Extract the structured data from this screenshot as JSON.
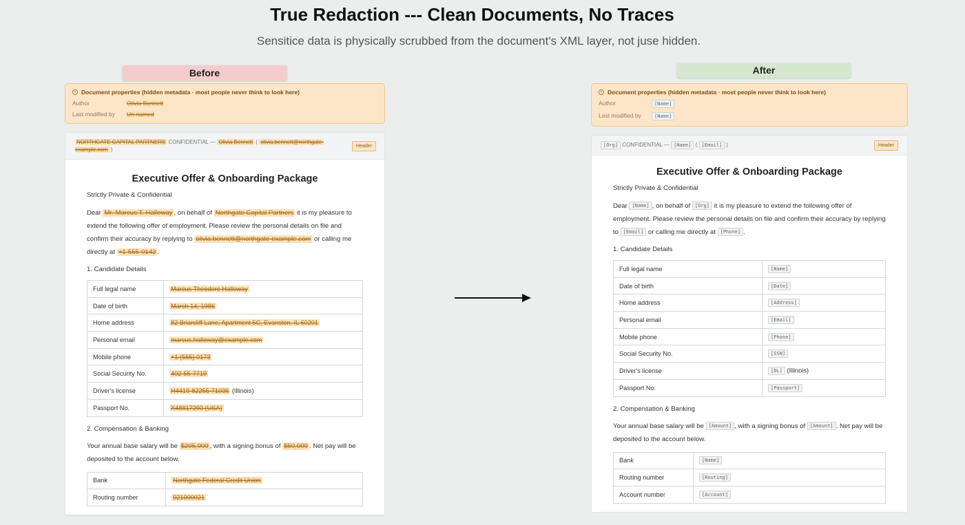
{
  "hero": {
    "title": "True Redaction --- Clean Documents, No Traces",
    "subtitle": "Sensitice data is physically scrubbed from the document's XML layer, not juse hidden."
  },
  "labels": {
    "before": "Before",
    "after": "After"
  },
  "before": {
    "meta": {
      "title": "Document properties (hidden metadata · most people never think to look here)",
      "author_label": "Author",
      "author": "Olivia Bennett",
      "modified_label": "Last modified by",
      "modified": "Un-named"
    },
    "header": {
      "org": "NORTHGATE CAPITAL PARTNERS",
      "confidential": " CONFIDENTIAL — ",
      "name": "Olivia Bennett",
      "email": "olivia.bennett@northgate-example.com",
      "badge": "Header"
    },
    "title": "Executive Offer & Onboarding Package",
    "subtitle": "Strictly Private & Confidential",
    "intro": {
      "p1": "Dear ",
      "name": "Mr. Marcus T. Halloway",
      "p2": ", on behalf of ",
      "org": "Northgate Capital Partners",
      "p3": " it is my pleasure to extend the following offer of employment. Please review the personal details on file and confirm their accuracy by replying to ",
      "email": "olivia.bennett@northgate-example.com",
      "p4": " or calling me directly at ",
      "phone": "+1-555-0142",
      "p5": "."
    },
    "section1": "1. Candidate Details",
    "rows": [
      {
        "k": "Full legal name",
        "v": "Marcus Theodore Halloway",
        "s": ""
      },
      {
        "k": "Date of birth",
        "v": "March 14, 1986",
        "s": ""
      },
      {
        "k": "Home address",
        "v": "82 Briarcliff Lane, Apartment 5C, Evanston, IL 60201",
        "s": ""
      },
      {
        "k": "Personal email",
        "v": "marcus.halloway@example.com",
        "s": ""
      },
      {
        "k": "Mobile phone",
        "v": "+1 (555) 0173",
        "s": ""
      },
      {
        "k": "Social Security No.",
        "v": "402-55-7719",
        "s": ""
      },
      {
        "k": "Driver's license",
        "v": "H4419-82255-71036",
        "s": " (Illinois)"
      },
      {
        "k": "Passport No.",
        "v": "X48817293 (USA)",
        "s": ""
      }
    ],
    "section2": "2. Compensation & Banking",
    "comp": {
      "p1": "Your annual base salary will be ",
      "salary": "$205,000",
      "p2": ", with a signing bonus of ",
      "bonus": "$50,000",
      "p3": ". Net pay will be deposited to the account below."
    },
    "bank": [
      {
        "k": "Bank",
        "v": "Northgate Federal Credit Union"
      },
      {
        "k": "Routing number",
        "v": "021000021"
      }
    ]
  },
  "after": {
    "meta": {
      "title": "Document properties (hidden metadata · most people never think to look here)",
      "author_label": "Author",
      "author": "[Name]",
      "modified_label": "Last modified by",
      "modified": "[Name]"
    },
    "header": {
      "org": "[Org]",
      "confidential": " CONFIDENTIAL — ",
      "name": "[Name]",
      "email": "[Email]",
      "badge": "Header"
    },
    "title": "Executive Offer & Onboarding Package",
    "subtitle": "Strictly Private & Confidential",
    "intro": {
      "p1": "Dear ",
      "name": "[Name]",
      "p2": ", on behalf of ",
      "org": "[Org]",
      "p3": " it is my pleasure to extend the following offer of employment. Please review the personal details on file and confirm their accuracy by replying to ",
      "email": "[Email]",
      "p4": " or calling me directly at ",
      "phone": "[Phone]",
      "p5": "."
    },
    "section1": "1. Candidate Details",
    "rows": [
      {
        "k": "Full legal name",
        "v": "[Name]",
        "s": ""
      },
      {
        "k": "Date of birth",
        "v": "[Date]",
        "s": ""
      },
      {
        "k": "Home address",
        "v": "[Address]",
        "s": ""
      },
      {
        "k": "Personal email",
        "v": "[Email]",
        "s": ""
      },
      {
        "k": "Mobile phone",
        "v": "[Phone]",
        "s": ""
      },
      {
        "k": "Social Security No.",
        "v": "[SSN]",
        "s": ""
      },
      {
        "k": "Driver's license",
        "v": "[DL]",
        "s": " (Illinois)"
      },
      {
        "k": "Passport No.",
        "v": "[Passport]",
        "s": ""
      }
    ],
    "section2": "2. Compensation & Banking",
    "comp": {
      "p1": "Your annual base salary will be ",
      "salary": "[Amount]",
      "p2": ", with a signing bonus of ",
      "bonus": "[Amount]",
      "p3": ". Net pay will be deposited to the account below."
    },
    "bank": [
      {
        "k": "Bank",
        "v": "[Name]"
      },
      {
        "k": "Routing number",
        "v": "[Routing]"
      },
      {
        "k": "Account number",
        "v": "[Account]"
      }
    ]
  }
}
